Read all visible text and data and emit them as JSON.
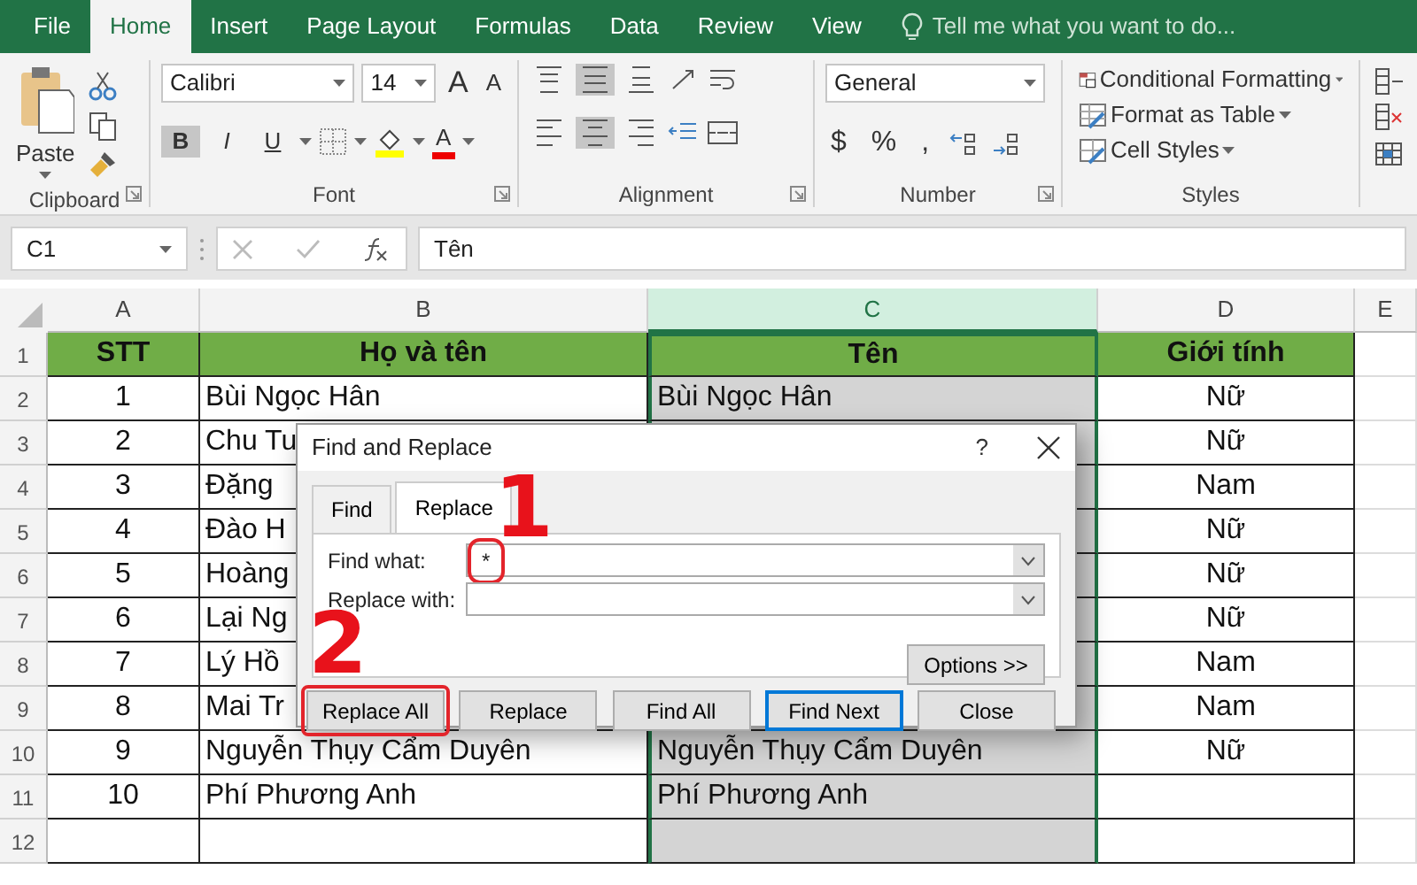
{
  "tabs": [
    {
      "label": "File",
      "selected": false
    },
    {
      "label": "Home",
      "selected": true
    },
    {
      "label": "Insert",
      "selected": false
    },
    {
      "label": "Page Layout",
      "selected": false
    },
    {
      "label": "Formulas",
      "selected": false
    },
    {
      "label": "Data",
      "selected": false
    },
    {
      "label": "Review",
      "selected": false
    },
    {
      "label": "View",
      "selected": false
    }
  ],
  "tell_me": "Tell me what you want to do...",
  "ribbon": {
    "clipboard": {
      "label": "Clipboard",
      "paste": "Paste"
    },
    "font": {
      "label": "Font",
      "name": "Calibri",
      "size": "14",
      "grow": "A",
      "shrink": "A",
      "color_label": "A",
      "styles": [
        {
          "label": "B",
          "kind": "bold",
          "selected": true
        },
        {
          "label": "I",
          "kind": "italic",
          "selected": false
        },
        {
          "label": "U",
          "kind": "underline",
          "selected": false
        }
      ]
    },
    "alignment": {
      "label": "Alignment",
      "buttons": [
        {
          "kind": "top",
          "selected": false
        },
        {
          "kind": "middle",
          "selected": true
        },
        {
          "kind": "bottom",
          "selected": false
        },
        {
          "kind": "left",
          "selected": false
        },
        {
          "kind": "center",
          "selected": true
        },
        {
          "kind": "right",
          "selected": false
        }
      ]
    },
    "number": {
      "label": "Number",
      "format": "General",
      "symbols": [
        "$",
        "%",
        ","
      ]
    },
    "styles": {
      "label": "Styles",
      "items": [
        "Conditional Formatting",
        "Format as Table",
        "Cell Styles"
      ]
    }
  },
  "formula_bar": {
    "name_box": "C1",
    "content": "Tên"
  },
  "sheet": {
    "columns": [
      {
        "label": "A",
        "selected": false
      },
      {
        "label": "B",
        "selected": false
      },
      {
        "label": "C",
        "selected": true
      },
      {
        "label": "D",
        "selected": false
      },
      {
        "label": "E",
        "selected": false
      }
    ],
    "rows": [
      {
        "number": "1",
        "kind": "header",
        "cells": [
          "STT",
          "Họ và tên",
          "Tên",
          "Giới tính"
        ]
      },
      {
        "number": "2",
        "kind": "data",
        "cells": [
          "1",
          "Bùi Ngọc Hân",
          "Bùi Ngọc Hân",
          "Nữ"
        ]
      },
      {
        "number": "3",
        "kind": "data",
        "cells": [
          "2",
          "Chu Tu",
          "",
          "Nữ"
        ]
      },
      {
        "number": "4",
        "kind": "data",
        "cells": [
          "3",
          "Đặng",
          "",
          "Nam"
        ]
      },
      {
        "number": "5",
        "kind": "data",
        "cells": [
          "4",
          "Đào H",
          "",
          "Nữ"
        ]
      },
      {
        "number": "6",
        "kind": "data",
        "cells": [
          "5",
          "Hoàng",
          "",
          "Nữ"
        ]
      },
      {
        "number": "7",
        "kind": "data",
        "cells": [
          "6",
          "Lại Ng",
          "",
          "Nữ"
        ]
      },
      {
        "number": "8",
        "kind": "data",
        "cells": [
          "7",
          "Lý Hồ",
          "",
          "Nam"
        ]
      },
      {
        "number": "9",
        "kind": "data",
        "cells": [
          "8",
          "Mai Tr",
          "",
          "Nam"
        ]
      },
      {
        "number": "10",
        "kind": "data",
        "cells": [
          "9",
          "Nguyễn Thụy Cẩm Duyên",
          "Nguyễn Thụy Cẩm Duyên",
          "Nữ"
        ]
      },
      {
        "number": "11",
        "kind": "data",
        "cells": [
          "10",
          "Phí Phương Anh",
          "Phí Phương Anh",
          ""
        ]
      },
      {
        "number": "12",
        "kind": "data",
        "cells": [
          "",
          "",
          "",
          ""
        ]
      }
    ]
  },
  "dialog": {
    "title": "Find and Replace",
    "help": "?",
    "tabs": [
      {
        "label": "Find",
        "selected": false
      },
      {
        "label": "Replace",
        "selected": true
      }
    ],
    "fields": [
      {
        "label": "Find what:",
        "value": "*",
        "highlighted": true,
        "callout": "1"
      },
      {
        "label": "Replace with:",
        "highlighted": false
      }
    ],
    "options": "Options >>",
    "buttons": [
      {
        "label": "Replace All",
        "highlighted": true,
        "default": false,
        "callout": "2"
      },
      {
        "label": "Replace",
        "highlighted": false,
        "default": false
      },
      {
        "label": "Find All",
        "highlighted": false,
        "default": false
      },
      {
        "label": "Find Next",
        "highlighted": false,
        "default": true
      },
      {
        "label": "Close",
        "highlighted": false,
        "default": false
      }
    ]
  }
}
